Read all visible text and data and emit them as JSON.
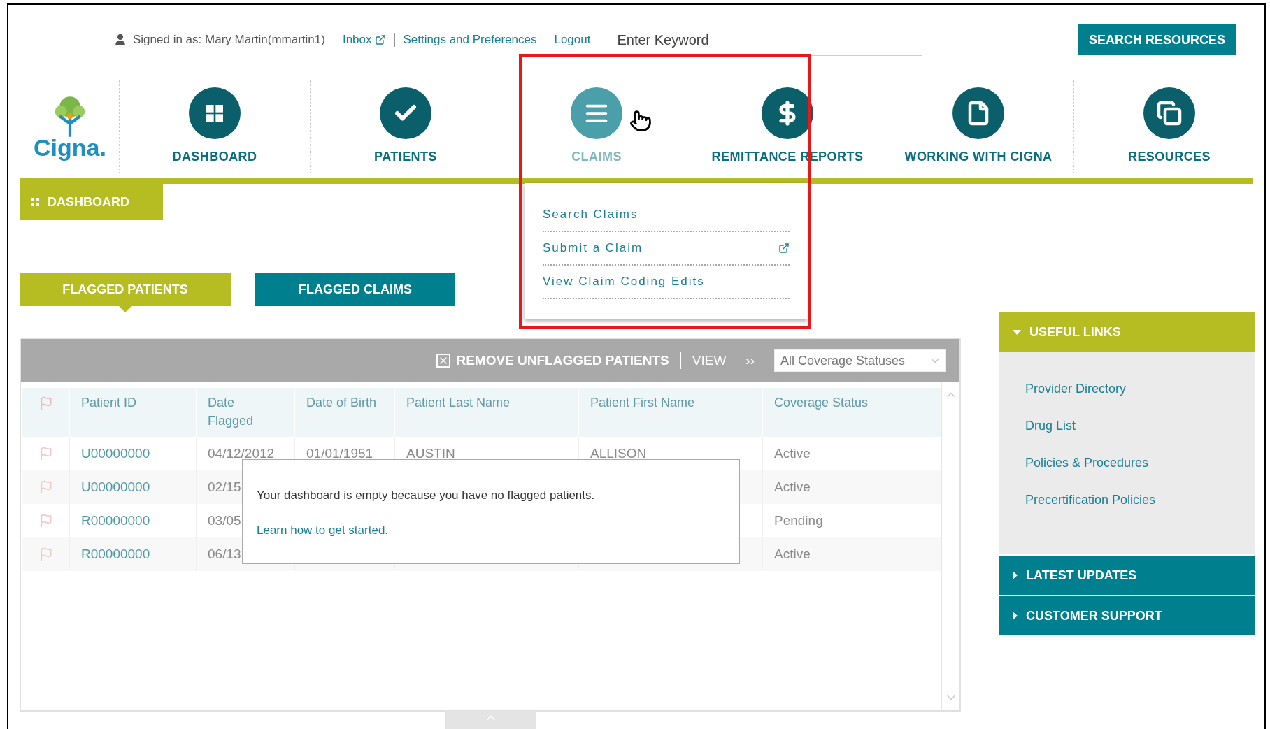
{
  "top_bar": {
    "signed_in": "Signed in as: Mary Martin(mmartin1)",
    "links": [
      {
        "label": "Inbox",
        "external": true
      },
      {
        "label": "Settings and Preferences",
        "external": false
      },
      {
        "label": "Logout",
        "external": false
      }
    ],
    "search": {
      "placeholder": "Enter Keyword"
    },
    "search_button": "SEARCH RESOURCES"
  },
  "logo": {
    "text": "Cigna."
  },
  "nav": [
    {
      "label": "DASHBOARD",
      "kind": "grid",
      "hovered": false
    },
    {
      "label": "PATIENTS",
      "kind": "check",
      "hovered": false
    },
    {
      "label": "CLAIMS",
      "kind": "list",
      "hovered": true
    },
    {
      "label": "REMITTANCE REPORTS",
      "kind": "dollar",
      "hovered": false
    },
    {
      "label": "WORKING WITH CIGNA",
      "kind": "document",
      "hovered": false
    },
    {
      "label": "RESOURCES",
      "kind": "windows",
      "hovered": false
    }
  ],
  "claims_menu": [
    {
      "label": "Search Claims",
      "external": false
    },
    {
      "label": "Submit a Claim",
      "external": true
    },
    {
      "label": "View Claim Coding Edits",
      "external": false
    }
  ],
  "page_tab": "DASHBOARD",
  "tabs": [
    {
      "label": "FLAGGED PATIENTS",
      "selected": true
    },
    {
      "label": "FLAGGED CLAIMS",
      "selected": false
    }
  ],
  "table": {
    "toolbar": {
      "remove": "REMOVE UNFLAGGED PATIENTS",
      "view": "VIEW",
      "arrows": "››",
      "filter": "All Coverage Statuses"
    },
    "columns": [
      "Patient ID",
      "Date Flagged",
      "Date of Birth",
      "Patient Last Name",
      "Patient First Name",
      "Coverage Status"
    ],
    "rows": [
      [
        "U00000000",
        "04/12/2012",
        "01/01/1951",
        "AUSTIN",
        "ALLISON",
        "Active"
      ],
      [
        "U00000000",
        "02/15",
        "",
        "",
        "",
        "Active"
      ],
      [
        "R00000000",
        "03/05",
        "",
        "",
        "",
        "Pending"
      ],
      [
        "R00000000",
        "06/13",
        "",
        "",
        "",
        "Active"
      ]
    ]
  },
  "empty_message": {
    "text": "Your dashboard is empty because you have no flagged patients.",
    "link": "Learn how to get started."
  },
  "sidebar": [
    {
      "title": "USEFUL LINKS",
      "expanded": true,
      "links": [
        "Provider Directory",
        "Drug List",
        "Policies & Procedures",
        "Precertification Policies"
      ]
    },
    {
      "title": "LATEST UPDATES",
      "expanded": false
    },
    {
      "title": "CUSTOMER SUPPORT",
      "expanded": false
    }
  ]
}
